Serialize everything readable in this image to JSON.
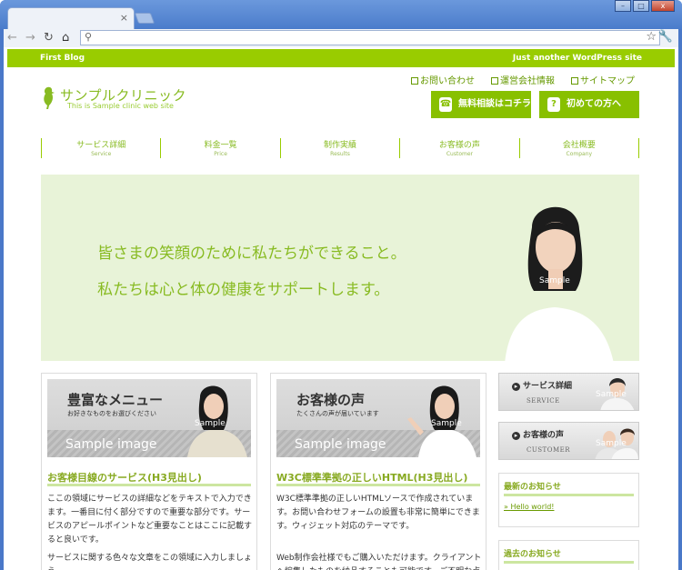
{
  "browser": {
    "tab_close": "×",
    "win_minimize": "–",
    "win_maximize": "□",
    "win_close": "x"
  },
  "site": {
    "topbar_left": "First Blog",
    "topbar_right": "Just another WordPress site",
    "toplinks": [
      "お問い合わせ",
      "運営会社情報",
      "サイトマップ"
    ],
    "logo_title": "サンプルクリニック",
    "logo_sub": "This is Sample clinic web site",
    "cta1": "無料相談はコチラ",
    "cta2": "初めての方へ",
    "cta2_icon": "?",
    "nav": [
      {
        "jp": "サービス詳細",
        "en": "Service"
      },
      {
        "jp": "料金一覧",
        "en": "Price"
      },
      {
        "jp": "制作実績",
        "en": "Results"
      },
      {
        "jp": "お客様の声",
        "en": "Customer"
      },
      {
        "jp": "会社概要",
        "en": "Company"
      }
    ],
    "hero_line1": "皆さまの笑顔のために私たちができること。",
    "hero_line2": "私たちは心と体の健康をサポートします。",
    "sample_label": "Sample",
    "col1": {
      "banner_title": "豊富なメニュー",
      "banner_sub": "お好きなものをお選びください",
      "banner_img": "Sample image",
      "heading": "お客様目線のサービス(H3見出し)",
      "p1": "ここの領域にサービスの詳細などをテキストで入力できます。一番目に付く部分ですので重要な部分です。サービスのアピールポイントなど重要なことはここに記載すると良いです。",
      "p2": "サービスに関する色々な文章をこの領域に入力しましょう。"
    },
    "col2": {
      "banner_title": "お客様の声",
      "banner_sub": "たくさんの声が届いています",
      "banner_img": "Sample image",
      "heading": "W3C標準準拠の正しいHTML(H3見出し)",
      "p1": "W3C標準準拠の正しいHTMLソースで作成されています。お問い合わせフォームの設置も非常に簡単にできます。ウィジェット対応のテーマです。",
      "p2": "Web制作会社様でもご購入いただけます。クライアントへ編集したものを納品することも可能です。ご不明な点"
    },
    "side": {
      "b1_title": "サービス詳細",
      "b1_en": "SERVICE",
      "b2_title": "お客様の声",
      "b2_en": "CUSTOMER",
      "box1_title": "最新のお知らせ",
      "box1_link": "Hello world!",
      "box2_title": "過去のお知らせ"
    }
  },
  "colors": {
    "accent": "#99cc00",
    "accent_text": "#88bb22",
    "hero_bg": "#e8f3d8"
  }
}
